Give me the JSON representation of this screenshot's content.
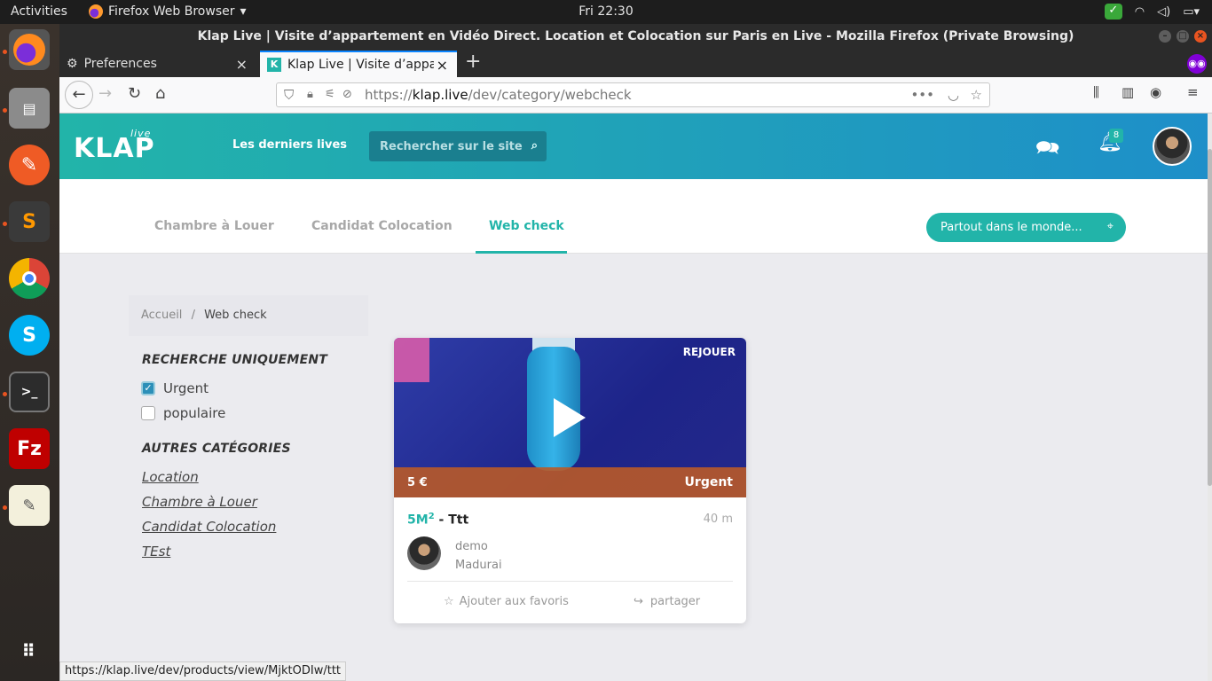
{
  "topbar": {
    "activities": "Activities",
    "app": "Firefox Web Browser",
    "clock": "Fri 22:30"
  },
  "window": {
    "title": "Klap Live | Visite d’appartement en Vidéo Direct. Location et Colocation sur Paris en Live - Mozilla Firefox (Private Browsing)"
  },
  "tabs": [
    {
      "label": "Preferences"
    },
    {
      "label": "Klap Live | Visite d’appar"
    }
  ],
  "urlbar": {
    "prefix": "https://",
    "host": "klap.live",
    "path": "/dev/category/webcheck"
  },
  "site": {
    "logo": "KLAP",
    "logo_sup": "live",
    "latest_lives": "Les derniers lives",
    "search_placeholder": "Rechercher sur le site",
    "notif_count": "8"
  },
  "subnav": {
    "items": [
      "Chambre à Louer",
      "Candidat Colocation",
      "Web check"
    ],
    "location": "Partout dans le monde..."
  },
  "breadcrumb": {
    "home": "Accueil",
    "sep": "/",
    "current": "Web check"
  },
  "filters": {
    "title": "RECHERCHE UNIQUEMENT",
    "options": [
      {
        "label": "Urgent",
        "checked": true
      },
      {
        "label": "populaire",
        "checked": false
      }
    ]
  },
  "categories": {
    "title": "AUTRES CATÉGORIES",
    "items": [
      "Location",
      "Chambre à Louer",
      "Candidat Colocation",
      "TEst"
    ]
  },
  "card": {
    "replay": "REJOUER",
    "price": "5 €",
    "tag": "Urgent",
    "size": "5M",
    "size_sup": "2",
    "name": "- Ttt",
    "distance": "40 m",
    "user": "demo",
    "city": "Madurai",
    "favorite": "Ajouter aux favoris",
    "share": "partager"
  },
  "statusbar": "https://klap.live/dev/products/view/MjktODIw/ttt",
  "colors": {
    "accent": "#22b4a9",
    "header_end": "#1e8fc9",
    "urgent_bar": "#b95a28"
  }
}
